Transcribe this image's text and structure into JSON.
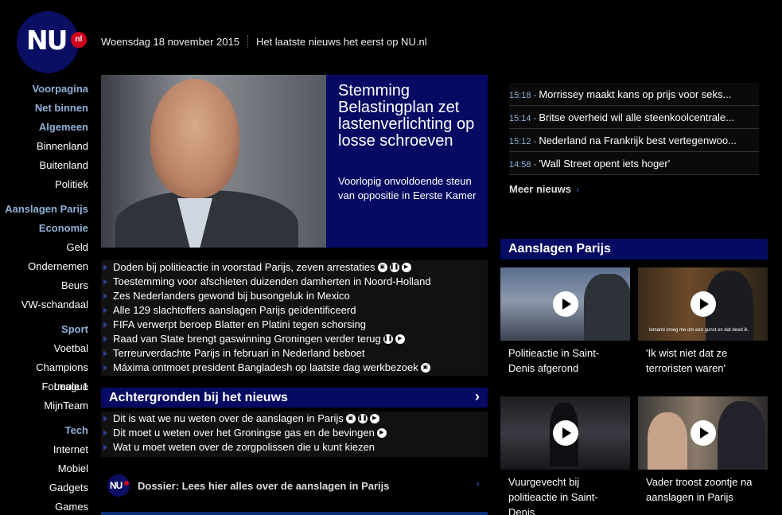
{
  "header": {
    "logo_text": "NU",
    "logo_badge": "nl",
    "date": "Woensdag 18 november 2015",
    "tagline": "Het laatste nieuws het eerst op NU.nl"
  },
  "sidebar": {
    "items": [
      {
        "label": "Voorpagina",
        "cat": true
      },
      {
        "label": "Net binnen",
        "cat": true
      },
      {
        "label": "Algemeen",
        "cat": true
      },
      {
        "label": "Binnenland",
        "cat": false
      },
      {
        "label": "Buitenland",
        "cat": false
      },
      {
        "label": "Politiek",
        "cat": false
      },
      {
        "label": "Aanslagen Parijs",
        "cat": true
      },
      {
        "label": "Economie",
        "cat": true
      },
      {
        "label": "Geld",
        "cat": false
      },
      {
        "label": "Ondernemen",
        "cat": false
      },
      {
        "label": "Beurs",
        "cat": false
      },
      {
        "label": "VW-schandaal",
        "cat": false
      },
      {
        "label": "Sport",
        "cat": true
      },
      {
        "label": "Voetbal",
        "cat": false
      },
      {
        "label": "Champions League",
        "cat": false
      },
      {
        "label": "Formule 1",
        "cat": false
      },
      {
        "label": "MijnTeam",
        "cat": false
      },
      {
        "label": "Tech",
        "cat": true
      },
      {
        "label": "Internet",
        "cat": false
      },
      {
        "label": "Mobiel",
        "cat": false
      },
      {
        "label": "Gadgets",
        "cat": false
      },
      {
        "label": "Games",
        "cat": false
      }
    ]
  },
  "hero": {
    "title": "Stemming Belastingplan zet lastenverlichting op losse schroeven",
    "summary": "Voorlopig onvoldoende steun van oppositie in Eerste Kamer"
  },
  "news": [
    {
      "text": "Doden bij politieactie in voorstad Parijs, zeven arrestaties",
      "icons": [
        "gallery",
        "audio",
        "video"
      ]
    },
    {
      "text": "Toestemming voor afschieten duizenden damherten in Noord-Holland",
      "icons": []
    },
    {
      "text": "Zes Nederlanders gewond bij busongeluk in Mexico",
      "icons": []
    },
    {
      "text": "Alle 129 slachtoffers aanslagen Parijs geïdentificeerd",
      "icons": []
    },
    {
      "text": "FIFA verwerpt beroep Blatter en Platini tegen schorsing",
      "icons": []
    },
    {
      "text": "Raad van State brengt gaswinning Groningen verder terug",
      "icons": [
        "audio",
        "video"
      ]
    },
    {
      "text": "Terreurverdachte Parijs in februari in Nederland beboet",
      "icons": []
    },
    {
      "text": "Máxima ontmoet president Bangladesh op laatste dag werkbezoek",
      "icons": [
        "gallery"
      ]
    }
  ],
  "background": {
    "title": "Achtergronden bij het nieuws",
    "items": [
      {
        "text": "Dit is wat we nu weten over de aanslagen in Parijs",
        "icons": [
          "gallery",
          "audio",
          "video"
        ]
      },
      {
        "text": "Dit moet u weten over het Groningse gas en de bevingen",
        "icons": [
          "video"
        ]
      },
      {
        "text": "Wat u moet weten over de zorgpolissen die u kunt kiezen",
        "icons": []
      }
    ]
  },
  "dossier": {
    "badge": "NU",
    "text": "Dossier: Lees hier alles over de aanslagen in Parijs"
  },
  "ticker": [
    {
      "time": "15:18",
      "text": "Morrissey maakt kans op prijs voor seks..."
    },
    {
      "time": "15:14",
      "text": "Britse overheid wil alle steenkoolcentrale..."
    },
    {
      "time": "15:12",
      "text": "Nederland na Frankrijk best vertegenwoo..."
    },
    {
      "time": "14:58",
      "text": "'Wall Street opent iets hoger'"
    }
  ],
  "meer_nieuws": "Meer nieuws",
  "aanslagen": {
    "title": "Aanslagen Parijs",
    "videos": [
      {
        "caption": "Politieactie in Saint-Denis afgerond",
        "subtitle": ""
      },
      {
        "caption": "'Ik wist niet dat ze terroristen waren'",
        "subtitle": "lemand vroeg me om een gunst en dat deed ik."
      },
      {
        "caption": "Vuurgevecht bij politieactie in Saint-Denis",
        "subtitle": ""
      },
      {
        "caption": "Vader troost zoontje na aanslagen in Parijs",
        "subtitle": ""
      }
    ]
  },
  "colors": {
    "navy": "#070a63",
    "category_blue": "#8fb1d7",
    "bullet_blue": "#2b3f8c",
    "badge_red": "#d0021b"
  }
}
